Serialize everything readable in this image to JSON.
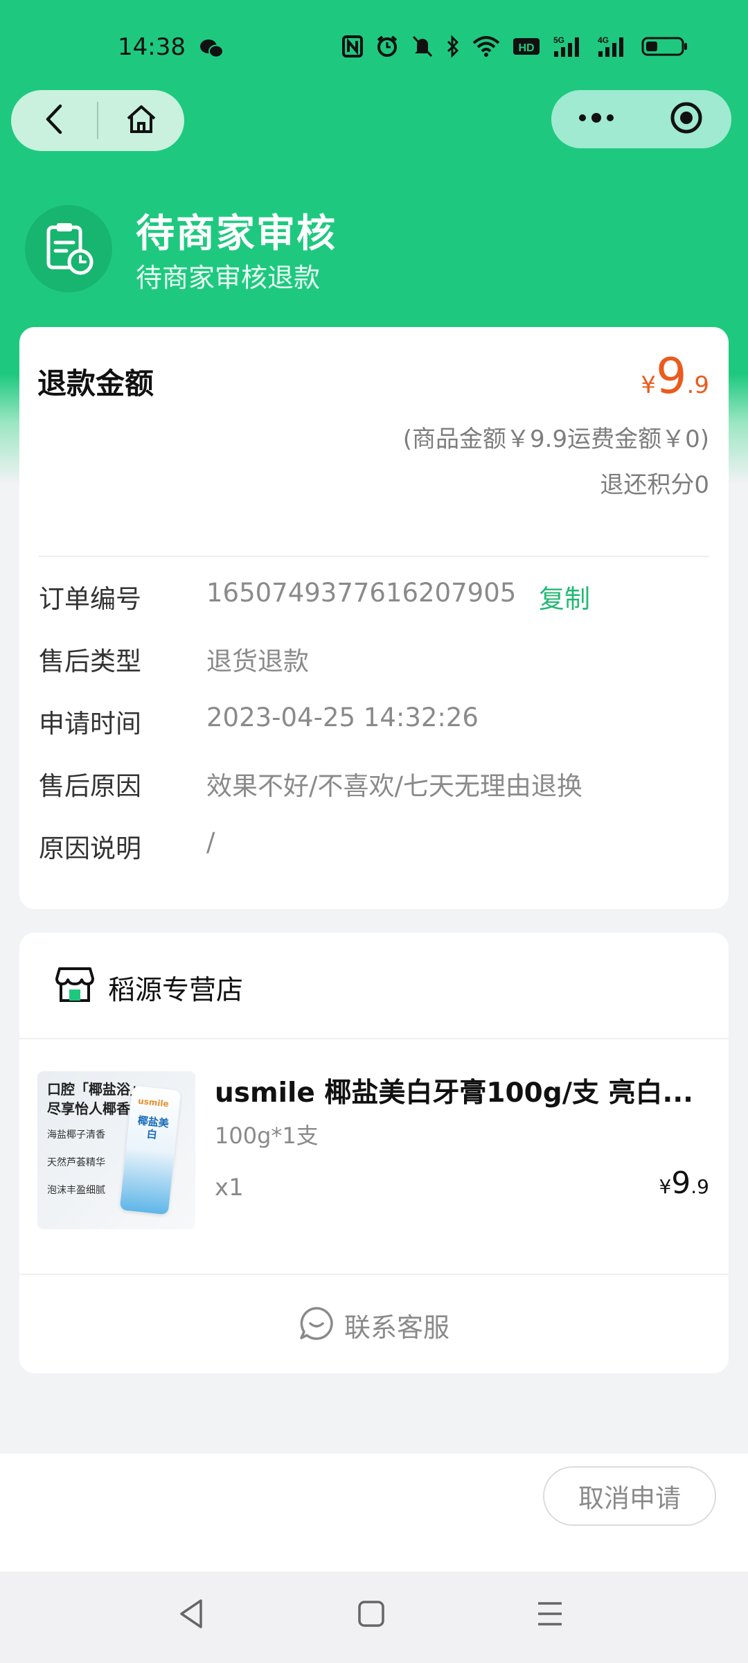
{
  "status_bar": {
    "time": "14:38",
    "icons": [
      "wechat-icon",
      "nfc-icon",
      "alarm-icon",
      "mute-icon",
      "bluetooth-icon",
      "wifi-icon",
      "hd-icon",
      "signal-5g-icon",
      "signal-4g-icon",
      "battery-icon"
    ],
    "hd_text": "HD",
    "net1": "5G",
    "net2": "4G"
  },
  "capsule": {
    "back_icon": "back-arrow-icon",
    "home_icon": "home-icon",
    "more_icon": "more-dots-icon",
    "close_icon": "target-icon"
  },
  "header": {
    "icon": "clipboard-clock-icon",
    "title": "待商家审核",
    "subtitle": "待商家审核退款"
  },
  "refund": {
    "label": "退款金额",
    "amount_currency": "¥",
    "amount_int": "9",
    "amount_dec": ".9",
    "breakdown": "(商品金额￥9.9运费金额￥0)",
    "points": "退还积分0"
  },
  "order_info": [
    {
      "key": "订单编号",
      "value": "1650749377616207905"
    },
    {
      "key": "售后类型",
      "value": "退货退款"
    },
    {
      "key": "申请时间",
      "value": "2023-04-25 14:32:26"
    },
    {
      "key": "售后原因",
      "value": "效果不好/不喜欢/七天无理由退换"
    },
    {
      "key": "原因说明",
      "value": "/"
    }
  ],
  "copy_label": "复制",
  "shop": {
    "icon": "store-icon",
    "name": "稻源专营店"
  },
  "product": {
    "name": "usmile 椰盐美白牙膏100g/支 亮白...",
    "spec": "100g*1支",
    "qty": "x1",
    "price_currency": "¥",
    "price_int": "9",
    "price_dec": ".9",
    "img_line1": "口腔「椰盐浴」",
    "img_line2": "尽享怡人椰香",
    "img_line3": "海盐椰子清香",
    "img_line4": "天然芦荟精华",
    "img_line5": "泡沫丰盈细腻",
    "img_brand": "usmile",
    "img_tube_label": "椰盐美白"
  },
  "customer_service": {
    "icon": "chat-bubble-icon",
    "label": "联系客服"
  },
  "cancel_button": "取消申请",
  "colors": {
    "brand_green": "#1ec97f",
    "price_orange": "#ea5b1d",
    "copy_green": "#22b873"
  }
}
